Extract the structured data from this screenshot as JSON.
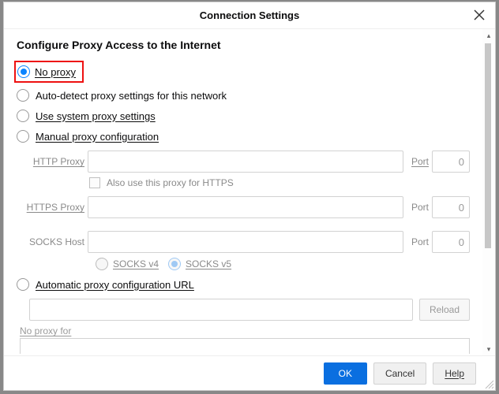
{
  "dialog": {
    "title": "Connection Settings",
    "section_title": "Configure Proxy Access to the Internet"
  },
  "options": {
    "no_proxy": "No proxy",
    "auto_detect": "Auto-detect proxy settings for this network",
    "system": "Use system proxy settings",
    "manual": "Manual proxy configuration",
    "auto_config_url": "Automatic proxy configuration URL"
  },
  "manual": {
    "http_label": "HTTP Proxy",
    "https_label": "HTTPS Proxy",
    "socks_label": "SOCKS Host",
    "port_label": "Port",
    "port_value_http": "0",
    "port_value_https": "0",
    "port_value_socks": "0",
    "also_https": "Also use this proxy for HTTPS",
    "socks_v4": "SOCKS v4",
    "socks_v5": "SOCKS v5"
  },
  "acu": {
    "reload_label": "Reload"
  },
  "no_proxy_for": {
    "label": "No proxy for"
  },
  "footer": {
    "ok": "OK",
    "cancel": "Cancel",
    "help": "Help"
  }
}
